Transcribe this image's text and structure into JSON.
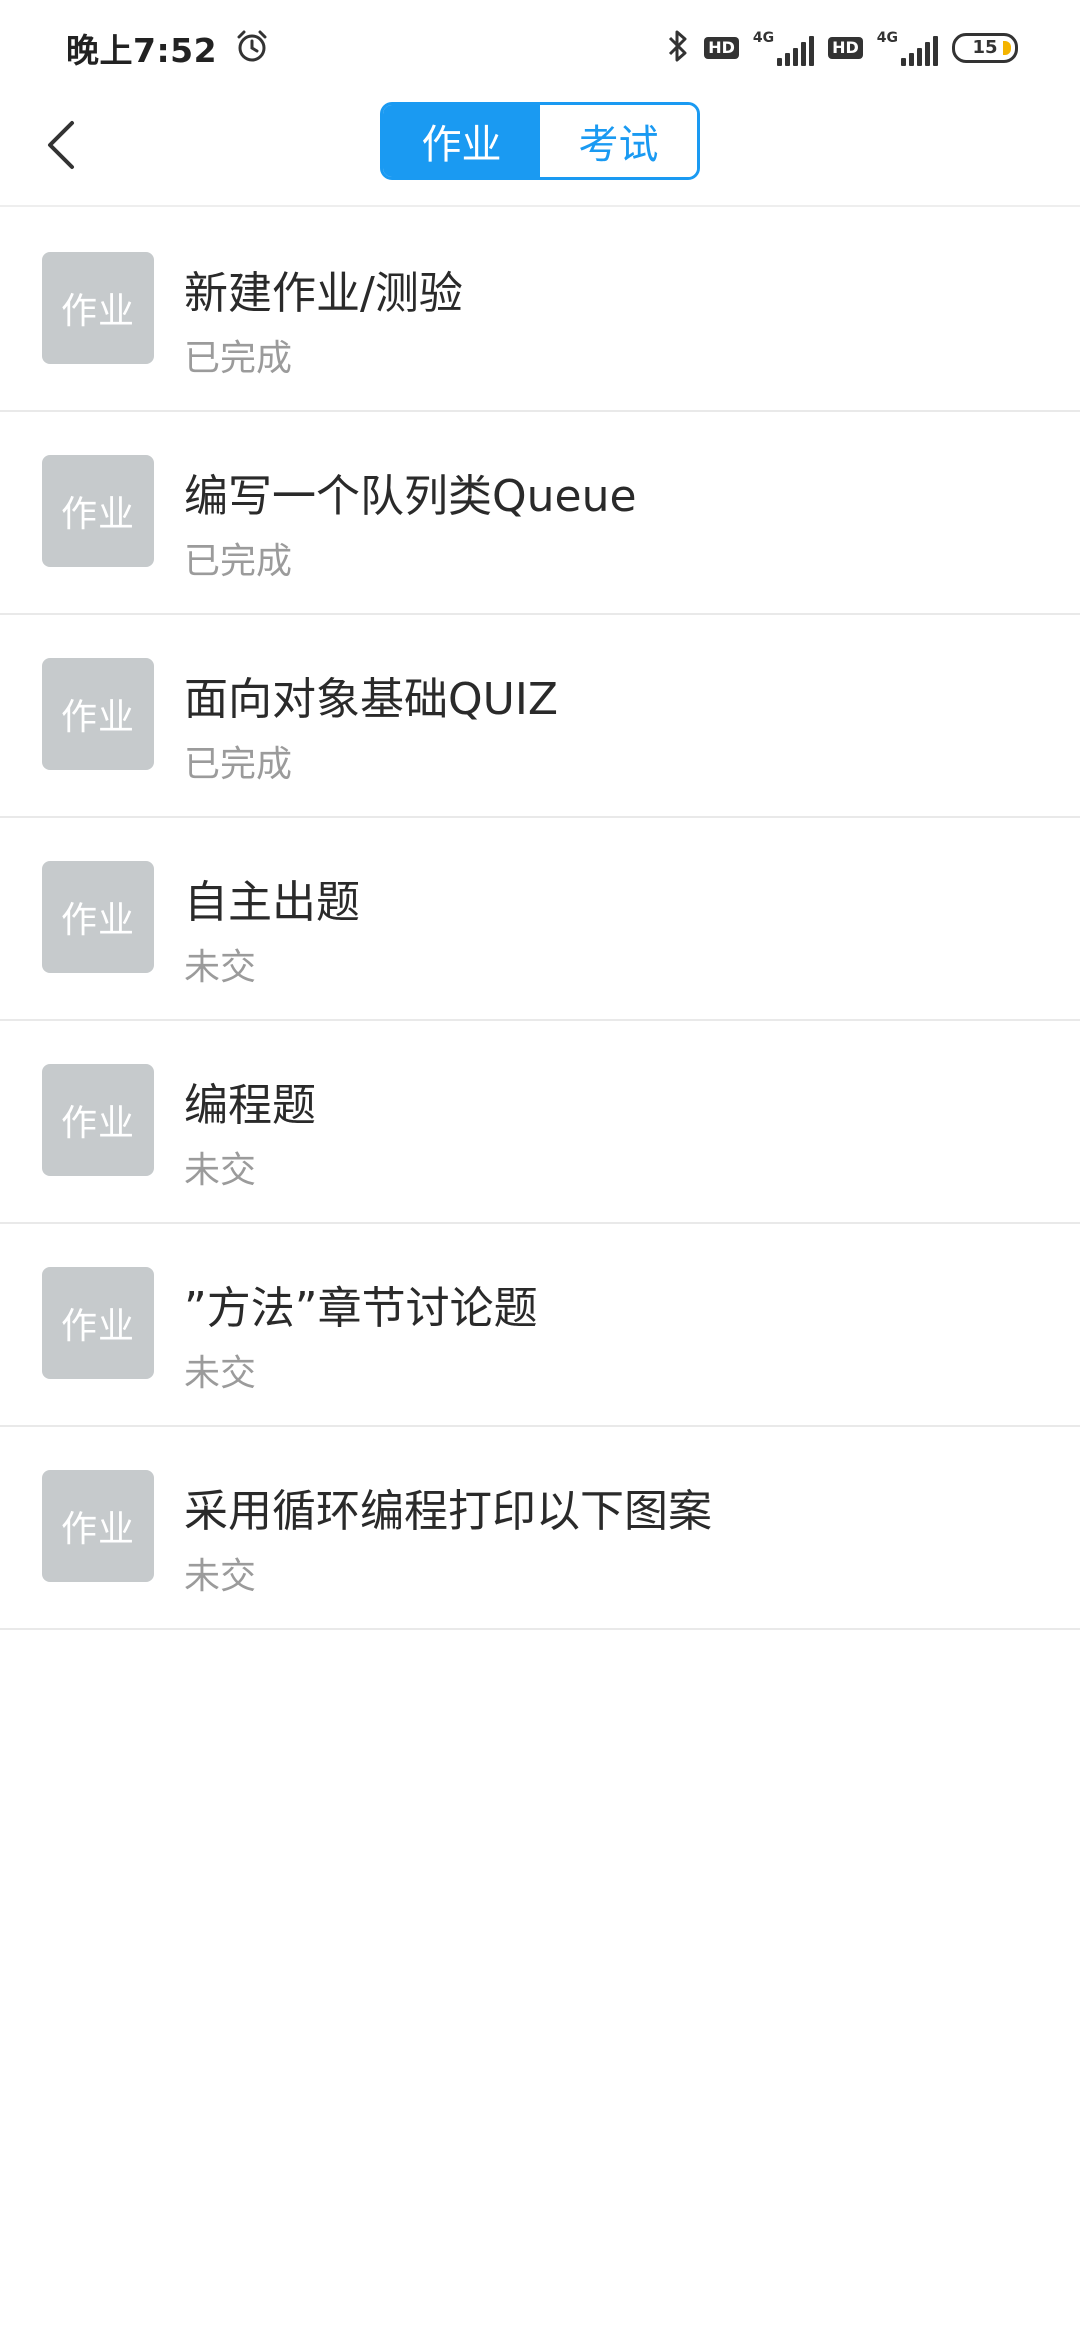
{
  "status_bar": {
    "time": "晚上7:52",
    "hd1": "HD",
    "net1": "4G",
    "hd2": "HD",
    "net2": "4G",
    "battery": "15",
    "icons": [
      "alarm-icon",
      "bluetooth-icon"
    ]
  },
  "header": {
    "tabs": [
      {
        "label": "作业",
        "active": true
      },
      {
        "label": "考试",
        "active": false
      }
    ]
  },
  "colors": {
    "accent": "#1a9af2",
    "icon_bg": "#c6cacc",
    "status_text": "#9b9b9b"
  },
  "items": [
    {
      "icon_label": "作业",
      "title": "新建作业/测验",
      "status": "已完成"
    },
    {
      "icon_label": "作业",
      "title": "编写一个队列类Queue",
      "status": "已完成"
    },
    {
      "icon_label": "作业",
      "title": "面向对象基础QUIZ",
      "status": "已完成"
    },
    {
      "icon_label": "作业",
      "title": "自主出题",
      "status": "未交"
    },
    {
      "icon_label": "作业",
      "title": "编程题",
      "status": "未交"
    },
    {
      "icon_label": "作业",
      "title": "”方法”章节讨论题",
      "status": "未交"
    },
    {
      "icon_label": "作业",
      "title": "采用循环编程打印以下图案",
      "status": "未交"
    }
  ]
}
